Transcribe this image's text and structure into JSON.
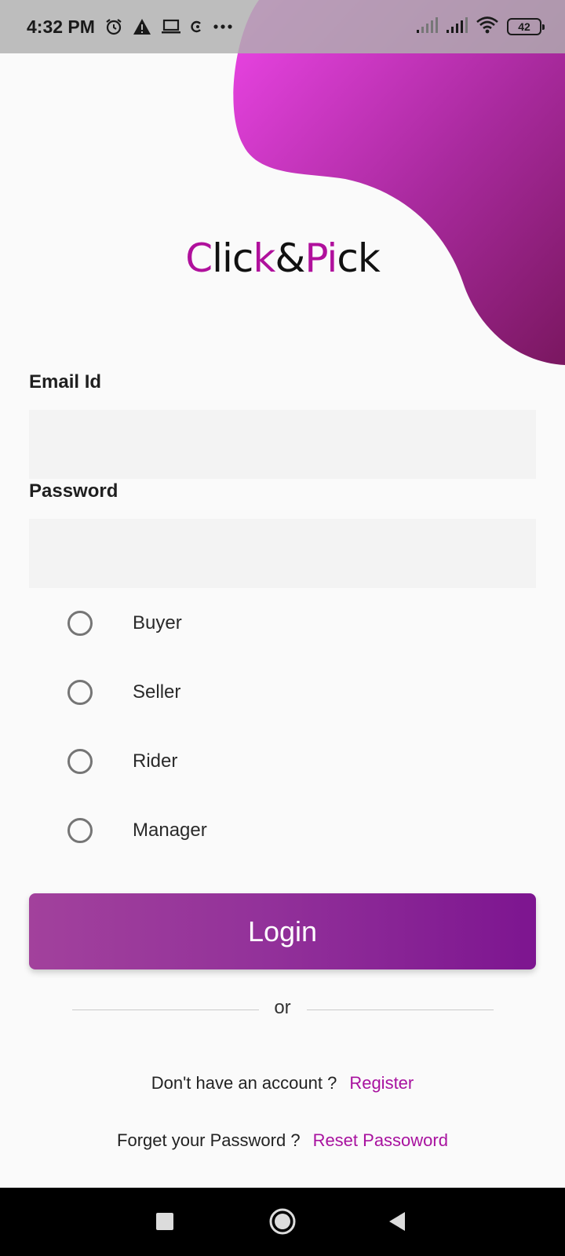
{
  "status_bar": {
    "time": "4:32 PM",
    "left_icons": [
      "alarm-icon",
      "warning-icon",
      "laptop-icon",
      "app-notification-icon",
      "more-icon"
    ],
    "right_icons": [
      "signal-weak-icon",
      "signal-icon",
      "wifi-icon"
    ],
    "battery_level": "42"
  },
  "brand": {
    "parts": [
      {
        "text": "C",
        "color": "#b0109c"
      },
      {
        "text": "lic",
        "color": "#111111"
      },
      {
        "text": "k",
        "color": "#b0109c"
      },
      {
        "text": "&",
        "color": "#111111"
      },
      {
        "text": "Pi",
        "color": "#b0109c"
      },
      {
        "text": "ck",
        "color": "#111111"
      }
    ]
  },
  "form": {
    "email_label": "Email Id",
    "email_value": "",
    "password_label": "Password",
    "password_value": "",
    "roles": [
      "Buyer",
      "Seller",
      "Rider",
      "Manager"
    ],
    "selected_role": null,
    "login_label": "Login",
    "divider_text": "or"
  },
  "footer": {
    "register_prompt": "Don't have an account ?",
    "register_link": "Register",
    "reset_prompt": "Forget your Password ?",
    "reset_link": "Reset Passoword"
  },
  "colors": {
    "accent": "#a8129f",
    "blob_start": "#ee45e8",
    "blob_end": "#7a1760",
    "button_start": "#a2419c",
    "button_end": "#7d1590"
  },
  "nav_bar": {
    "buttons": [
      "recents-icon",
      "home-icon",
      "back-icon"
    ]
  }
}
